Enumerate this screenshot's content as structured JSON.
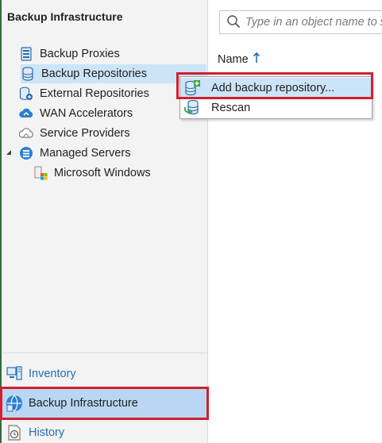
{
  "left_pane": {
    "title": "Backup Infrastructure",
    "tree": [
      {
        "label": "Backup Proxies",
        "icon": "proxy-icon"
      },
      {
        "label": "Backup Repositories",
        "icon": "repository-icon",
        "selected": true
      },
      {
        "label": "External Repositories",
        "icon": "external-repository-icon"
      },
      {
        "label": "WAN Accelerators",
        "icon": "wan-accelerator-icon"
      },
      {
        "label": "Service Providers",
        "icon": "cloud-provider-icon"
      },
      {
        "label": "Managed Servers",
        "icon": "managed-servers-icon",
        "expanded": true
      },
      {
        "label": "Microsoft Windows",
        "icon": "windows-server-icon"
      }
    ]
  },
  "nav": {
    "items": [
      {
        "label": "Inventory",
        "icon": "inventory-icon"
      },
      {
        "label": "Backup Infrastructure",
        "icon": "backup-infrastructure-icon",
        "active": true
      },
      {
        "label": "History",
        "icon": "history-icon"
      }
    ]
  },
  "search": {
    "placeholder": "Type in an object name to search for"
  },
  "table": {
    "columns": [
      {
        "label": "Name",
        "sort": "ascending"
      }
    ]
  },
  "context_menu": {
    "items": [
      {
        "label": "Add backup repository...",
        "icon": "add-repository-icon",
        "highlighted": true
      },
      {
        "label": "Rescan",
        "icon": "rescan-icon"
      }
    ]
  },
  "colors": {
    "selection": "#cce4f7",
    "nav_active": "#b9d7f2",
    "link_blue": "#1f6fb2",
    "highlight_red": "#d2202f",
    "accent_green": "#3aa845"
  }
}
